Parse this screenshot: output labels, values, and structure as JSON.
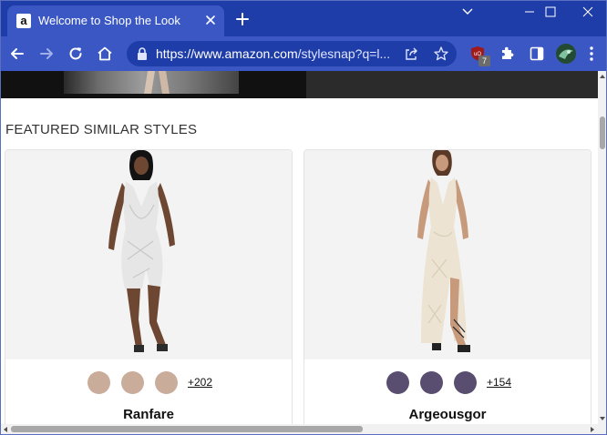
{
  "browser": {
    "tab": {
      "title": "Welcome to Shop the Look",
      "favicon_letter": "a"
    },
    "url": {
      "host": "https://www.amazon.com",
      "path": "/stylesnap?q=l..."
    },
    "extension_badge": "7"
  },
  "page": {
    "section_title": "FEATURED SIMILAR STYLES",
    "products": [
      {
        "brand": "Ranfare",
        "more_colors": "+202",
        "swatches": [
          "#c9ad9a",
          "#c9ad9a",
          "#c9ad9a"
        ],
        "dress_color": "#e6e6e6"
      },
      {
        "brand": "Argeousgor",
        "more_colors": "+154",
        "swatches": [
          "#5a4e70",
          "#5a4e70",
          "#5a4e70"
        ],
        "dress_color": "#ece3d3"
      }
    ]
  },
  "icons": [
    "amazon-favicon",
    "close-icon",
    "plus-icon",
    "chevron-down-icon",
    "minimize-icon",
    "maximize-icon",
    "window-close-icon",
    "back-arrow-icon",
    "forward-arrow-icon",
    "reload-icon",
    "home-icon",
    "lock-icon",
    "share-icon",
    "star-icon",
    "ublock-icon",
    "puzzle-icon",
    "side-panel-icon",
    "profile-avatar",
    "kebab-menu-icon"
  ],
  "colors": {
    "tabstrip": "#1f3da8",
    "toolbar": "#3a57c4"
  }
}
